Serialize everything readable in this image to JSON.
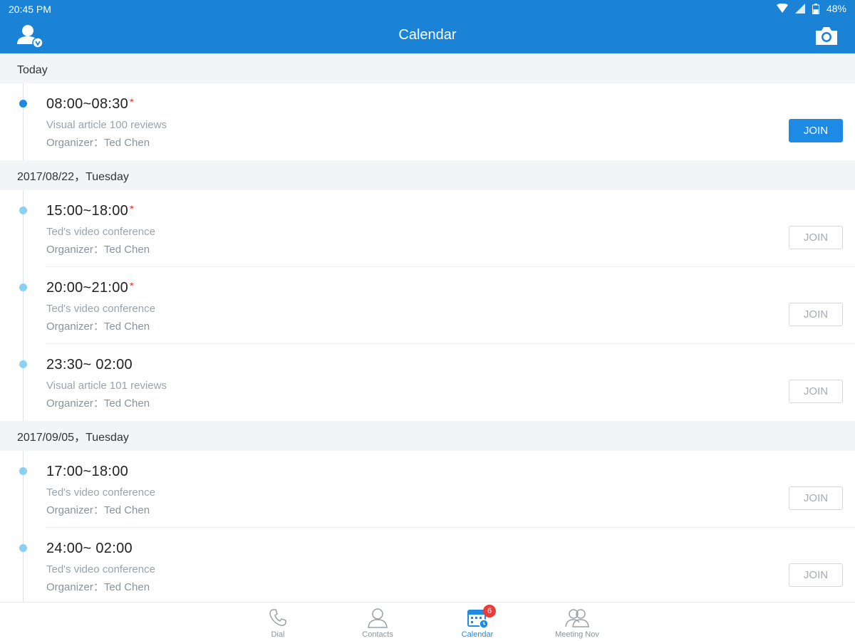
{
  "status_bar": {
    "time": "20:45 PM",
    "battery": "48%"
  },
  "app_bar": {
    "title": "Calendar"
  },
  "sections": [
    {
      "header": "Today",
      "meetings": [
        {
          "time": "08:00~08:30",
          "starred": "*",
          "subject": "Visual article 100 reviews",
          "organizer": "Organizer：Ted Chen",
          "join": "JOIN"
        }
      ]
    },
    {
      "header": "2017/08/22，Tuesday",
      "meetings": [
        {
          "time": "15:00~18:00",
          "starred": "*",
          "subject": "Ted's video conference",
          "organizer": "Organizer：Ted Chen",
          "join": "JOIN"
        },
        {
          "time": "20:00~21:00",
          "starred": "*",
          "subject": "Ted's video conference",
          "organizer": "Organizer：Ted Chen",
          "join": "JOIN"
        },
        {
          "time": "23:30~ 02:00",
          "subject": "Visual article 101 reviews",
          "organizer": "Organizer：Ted Chen",
          "join": "JOIN"
        }
      ]
    },
    {
      "header": "2017/09/05，Tuesday",
      "meetings": [
        {
          "time": "17:00~18:00",
          "subject": "Ted's video conference",
          "organizer": "Organizer：Ted Chen",
          "join": "JOIN"
        },
        {
          "time": "24:00~ 02:00",
          "subject": "Ted's video conference",
          "organizer": "Organizer：Ted Chen",
          "join": "JOIN"
        }
      ]
    }
  ],
  "bottom_nav": {
    "tabs": [
      {
        "label": "Dial",
        "icon": "phone-icon"
      },
      {
        "label": "Contacts",
        "icon": "contacts-icon"
      },
      {
        "label": "Calendar",
        "icon": "calendar-icon",
        "badge": "6"
      },
      {
        "label": "Meeting Nov",
        "icon": "meeting-now-icon"
      }
    ]
  },
  "colors": {
    "primary": "#1a83d5",
    "accent": "#1d8ae6",
    "badge": "#f03a3a",
    "star": "#e02626"
  }
}
